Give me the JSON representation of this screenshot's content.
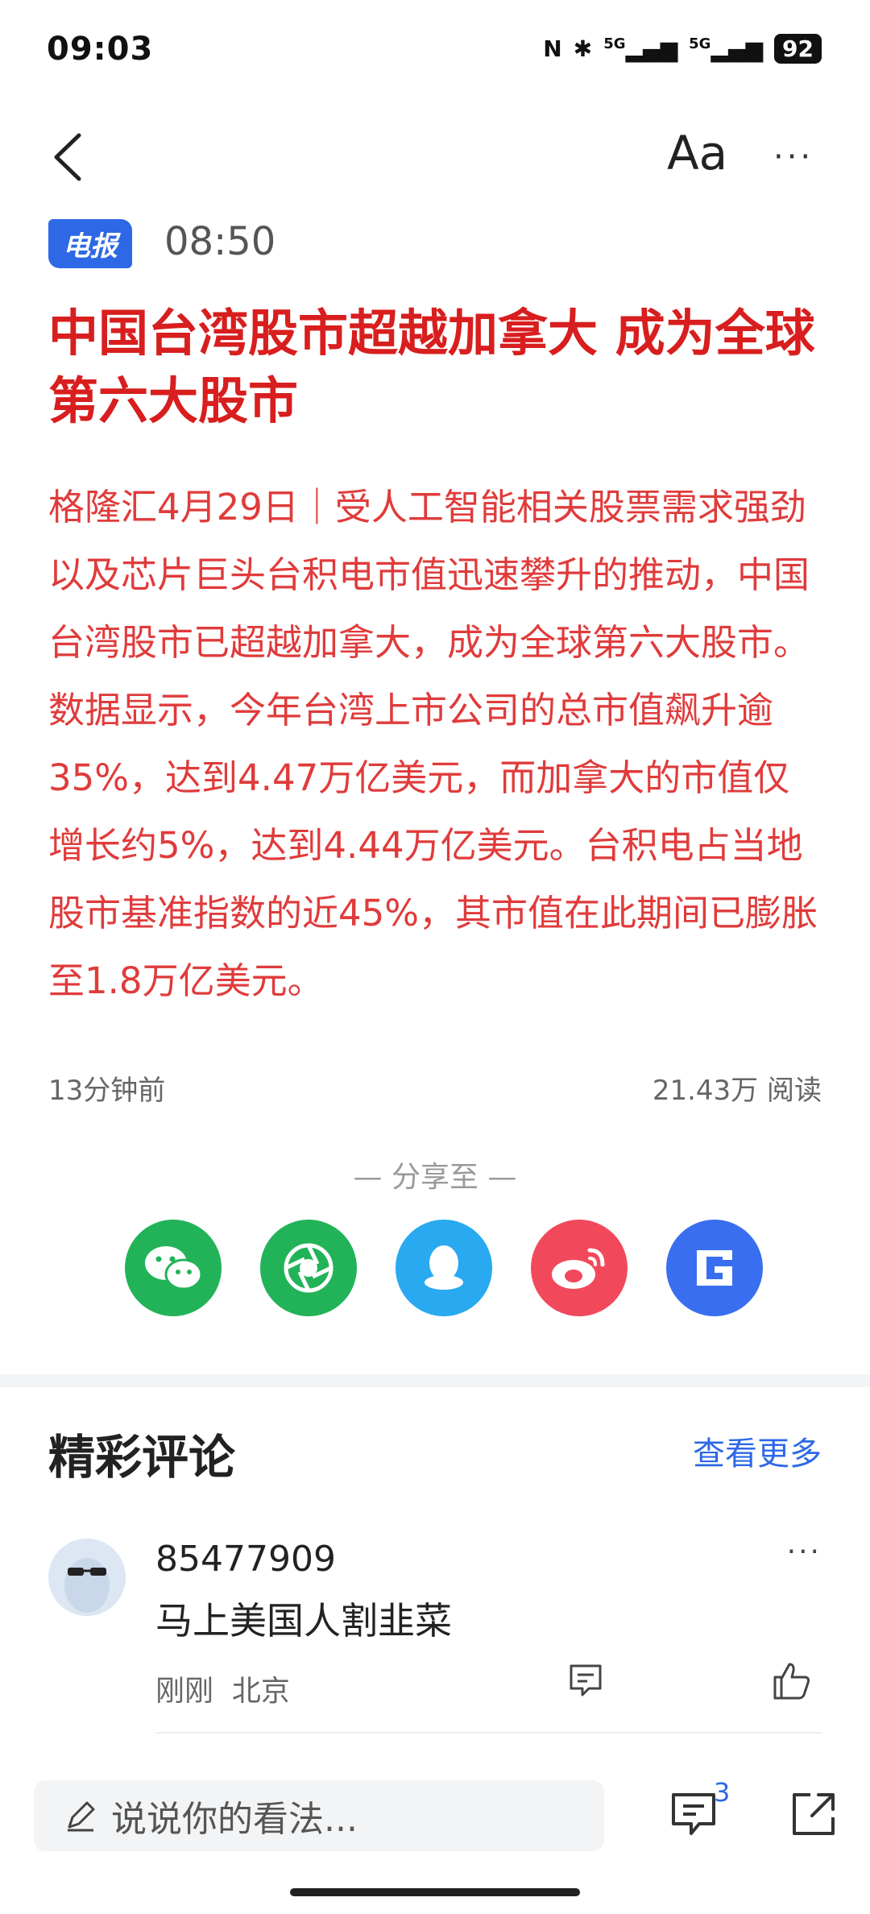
{
  "status_bar": {
    "time": "09:03",
    "battery": "92",
    "nfc": "N",
    "bluetooth": "✱",
    "sig1": "5G",
    "sig2": "5G"
  },
  "toolbar": {
    "font_label": "Aa",
    "more_label": "···"
  },
  "article": {
    "tag": "电报",
    "time": "08:50",
    "title": "中国台湾股市超越加拿大 成为全球第六大股市",
    "body": "格隆汇4月29日｜受人工智能相关股票需求强劲以及芯片巨头台积电市值迅速攀升的推动，中国台湾股市已超越加拿大，成为全球第六大股市。数据显示，今年台湾上市公司的总市值飙升逾35%，达到4.47万亿美元，而加拿大的市值仅增长约5%，达到4.44万亿美元。台积电占当地股市基准指数的近45%，其市值在此期间已膨胀至1.8万亿美元。",
    "posted": "13分钟前",
    "reads": "21.43万  阅读"
  },
  "share": {
    "label": "— 分享至 —",
    "buttons": [
      {
        "icon": "wechat-icon",
        "color": "#22b359"
      },
      {
        "icon": "moments-icon",
        "color": "#22b359"
      },
      {
        "icon": "qq-icon",
        "color": "#28a9f0"
      },
      {
        "icon": "weibo-icon",
        "color": "#f2485b"
      },
      {
        "icon": "g-logo-icon",
        "color": "#3a6ef0"
      }
    ]
  },
  "comments": {
    "title": "精彩评论",
    "view_more": "查看更多",
    "items": [
      {
        "user": "85477909",
        "text": "马上美国人割韭菜",
        "time": "刚刚",
        "location": "北京",
        "more": "···"
      }
    ]
  },
  "bottom_bar": {
    "placeholder": "说说你的看法...",
    "comment_count": "3"
  }
}
